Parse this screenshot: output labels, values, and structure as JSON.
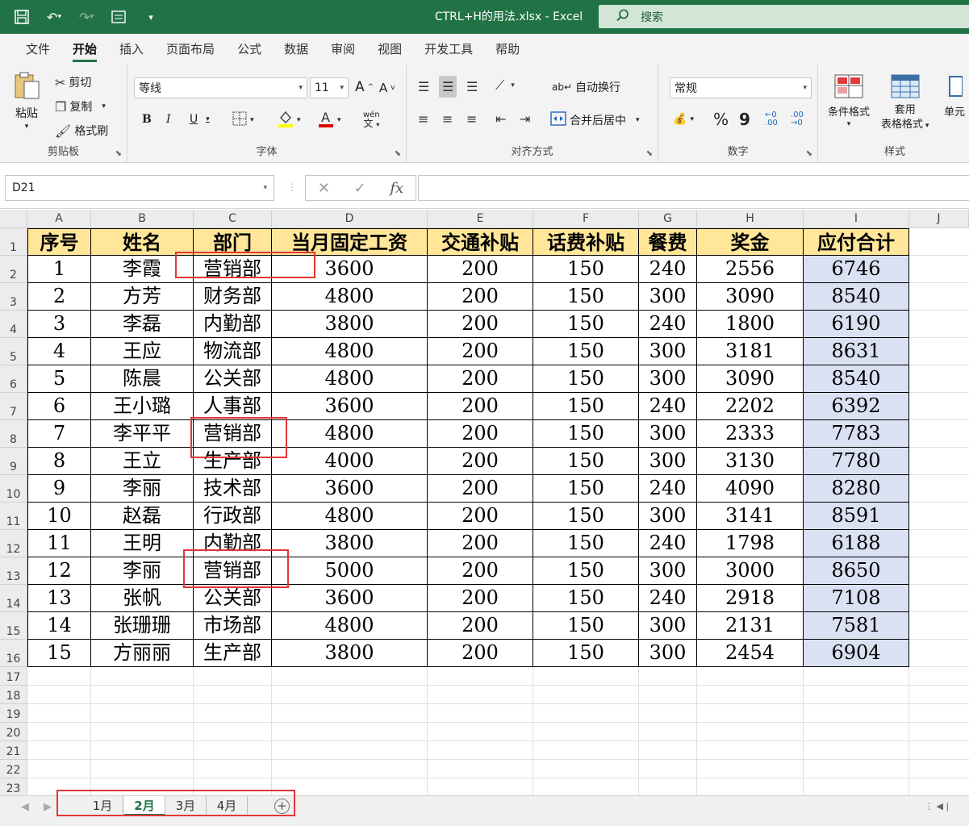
{
  "window": {
    "title": "CTRL+H的用法.xlsx  -  Excel",
    "search_placeholder": "搜索"
  },
  "ribbon_tabs": [
    "文件",
    "开始",
    "插入",
    "页面布局",
    "公式",
    "数据",
    "审阅",
    "视图",
    "开发工具",
    "帮助"
  ],
  "active_tab": "开始",
  "clipboard": {
    "paste": "粘贴",
    "cut": "剪切",
    "copy": "复制",
    "format_painter": "格式刷",
    "label": "剪贴板"
  },
  "font": {
    "name": "等线",
    "size": "11",
    "label": "字体",
    "bold": "B",
    "italic": "I",
    "underline": "U",
    "phonetic": "wén"
  },
  "alignment": {
    "wrap": "自动换行",
    "merge": "合并后居中",
    "label": "对齐方式"
  },
  "number": {
    "format": "常规",
    "label": "数字",
    "percent": "%",
    "comma": "9",
    "inc_dec": "←0 .00",
    "dec_dec": ".00 →0"
  },
  "styles": {
    "conditional": "条件格式",
    "table_line1": "套用",
    "table_line2": "表格格式",
    "cell": "单元",
    "label": "样式"
  },
  "formula_bar": {
    "name_box": "D21",
    "cancel": "✕",
    "enter": "✓",
    "fx": "fx",
    "formula": ""
  },
  "columns": [
    "A",
    "B",
    "C",
    "D",
    "E",
    "F",
    "G",
    "H",
    "I",
    "J"
  ],
  "rows": [
    "1",
    "2",
    "3",
    "4",
    "5",
    "6",
    "7",
    "8",
    "9",
    "10",
    "11",
    "12",
    "13",
    "14",
    "15",
    "16",
    "17",
    "18",
    "19",
    "20",
    "21",
    "22",
    "23"
  ],
  "table": {
    "headers": [
      "序号",
      "姓名",
      "部门",
      "当月固定工资",
      "交通补贴",
      "话费补贴",
      "餐费",
      "奖金",
      "应付合计"
    ],
    "data": [
      [
        "1",
        "李霞",
        "营销部",
        "3600",
        "200",
        "150",
        "240",
        "2556",
        "6746"
      ],
      [
        "2",
        "方芳",
        "财务部",
        "4800",
        "200",
        "150",
        "300",
        "3090",
        "8540"
      ],
      [
        "3",
        "李磊",
        "内勤部",
        "3800",
        "200",
        "150",
        "240",
        "1800",
        "6190"
      ],
      [
        "4",
        "王应",
        "物流部",
        "4800",
        "200",
        "150",
        "300",
        "3181",
        "8631"
      ],
      [
        "5",
        "陈晨",
        "公关部",
        "4800",
        "200",
        "150",
        "300",
        "3090",
        "8540"
      ],
      [
        "6",
        "王小璐",
        "人事部",
        "3600",
        "200",
        "150",
        "240",
        "2202",
        "6392"
      ],
      [
        "7",
        "李平平",
        "营销部",
        "4800",
        "200",
        "150",
        "300",
        "2333",
        "7783"
      ],
      [
        "8",
        "王立",
        "生产部",
        "4000",
        "200",
        "150",
        "300",
        "3130",
        "7780"
      ],
      [
        "9",
        "李丽",
        "技术部",
        "3600",
        "200",
        "150",
        "240",
        "4090",
        "8280"
      ],
      [
        "10",
        "赵磊",
        "行政部",
        "4800",
        "200",
        "150",
        "300",
        "3141",
        "8591"
      ],
      [
        "11",
        "王明",
        "内勤部",
        "3800",
        "200",
        "150",
        "240",
        "1798",
        "6188"
      ],
      [
        "12",
        "李丽",
        "营销部",
        "5000",
        "200",
        "150",
        "300",
        "3000",
        "8650"
      ],
      [
        "13",
        "张帆",
        "公关部",
        "3600",
        "200",
        "150",
        "240",
        "2918",
        "7108"
      ],
      [
        "14",
        "张珊珊",
        "市场部",
        "4800",
        "200",
        "150",
        "300",
        "2131",
        "7581"
      ],
      [
        "15",
        "方丽丽",
        "生产部",
        "3800",
        "200",
        "150",
        "300",
        "2454",
        "6904"
      ]
    ]
  },
  "sheets": [
    "1月",
    "2月",
    "3月",
    "4月"
  ],
  "active_sheet": "2月",
  "colors": {
    "excel_green": "#217346",
    "header_fill": "#ffe699",
    "total_fill": "#dae1f3",
    "highlight_box": "#e23636"
  }
}
